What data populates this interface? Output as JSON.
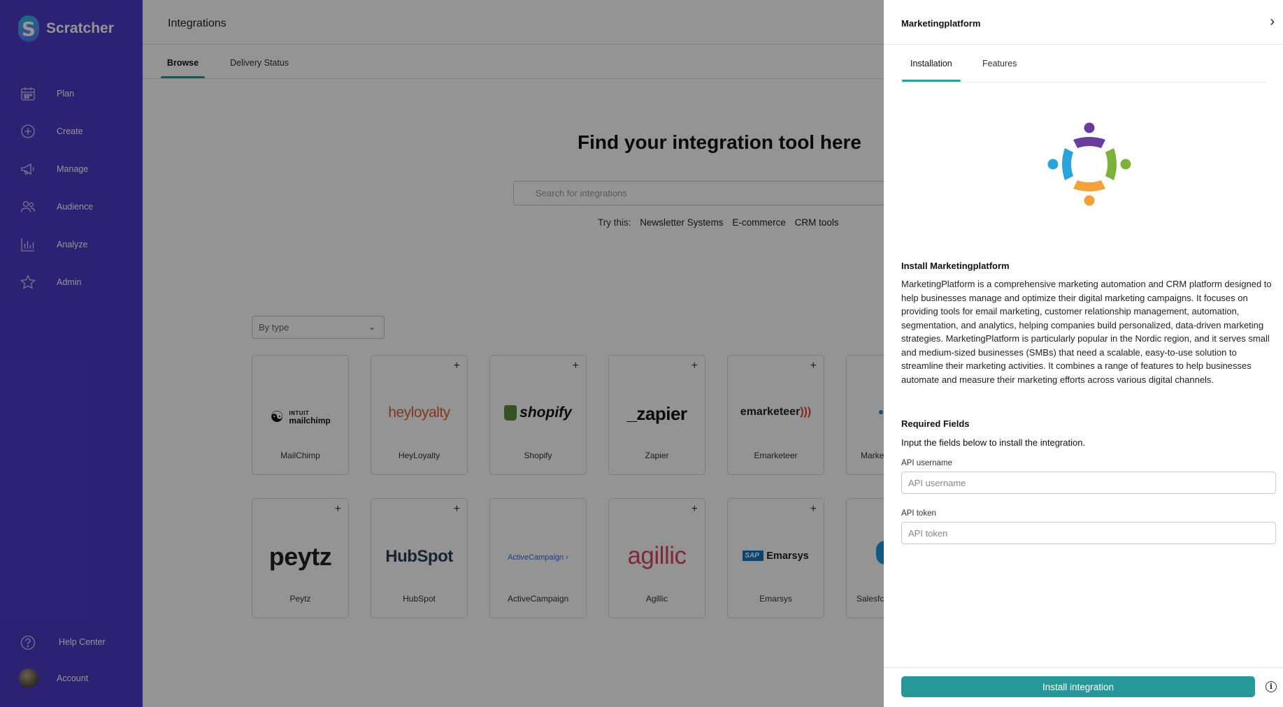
{
  "sidebar": {
    "brand": "Scratcher",
    "brand_mark": "S",
    "items": [
      {
        "label": "Plan",
        "icon": "calendar-icon"
      },
      {
        "label": "Create",
        "icon": "plus-circle-icon"
      },
      {
        "label": "Manage",
        "icon": "megaphone-icon"
      },
      {
        "label": "Audience",
        "icon": "users-icon"
      },
      {
        "label": "Analyze",
        "icon": "bar-chart-icon"
      },
      {
        "label": "Admin",
        "icon": "star-icon"
      }
    ],
    "help": "Help Center",
    "account": "Account",
    "bg_color": "#4f3ac8"
  },
  "main": {
    "title": "Integrations",
    "tabs": [
      {
        "label": "Browse",
        "active": true
      },
      {
        "label": "Delivery Status",
        "active": false
      }
    ],
    "hero": "Find your integration tool here",
    "search_placeholder": "Search for integrations",
    "try_label": "Try this:",
    "suggestions": [
      "Newsletter Systems",
      "E-commerce",
      "CRM tools"
    ],
    "filter": "By type",
    "cards_row1": [
      {
        "name": "MailChimp",
        "logo": "intuit mailchimp",
        "logo_top": "INTUIT",
        "logo_bottom": "mailchimp"
      },
      {
        "name": "HeyLoyalty",
        "logo": "heyloyalty"
      },
      {
        "name": "Shopify",
        "logo": "shopify"
      },
      {
        "name": "Zapier",
        "logo": "_zapier"
      },
      {
        "name": "Emarketeer",
        "logo": "emarketeer"
      },
      {
        "name": "Marke"
      }
    ],
    "cards_row2": [
      {
        "name": "Peytz",
        "logo": "peytz"
      },
      {
        "name": "HubSpot",
        "logo": "HubSpot"
      },
      {
        "name": "ActiveCampaign",
        "logo": "ActiveCampaign"
      },
      {
        "name": "Agillic",
        "logo": "agillic"
      },
      {
        "name": "Emarsys",
        "logo": "Emarsys",
        "logo_prefix": "SAP"
      },
      {
        "name": "Salesfc"
      }
    ],
    "plus": "+"
  },
  "panel": {
    "title": "Marketingplatform",
    "tabs": [
      {
        "label": "Installation",
        "active": true
      },
      {
        "label": "Features",
        "active": false
      }
    ],
    "install_heading": "Install Marketingplatform",
    "description": "MarketingPlatform is a comprehensive marketing automation and CRM platform designed to help businesses manage and optimize their digital marketing campaigns. It focuses on providing tools for email marketing, customer relationship management, automation, segmentation, and analytics, helping companies build personalized, data-driven marketing strategies. MarketingPlatform is particularly popular in the Nordic region, and it serves small and medium-sized businesses (SMBs) that need a scalable, easy-to-use solution to streamline their marketing activities. It combines a range of features to help businesses automate and measure their marketing efforts across various digital channels.",
    "required_heading": "Required Fields",
    "required_sub": "Input the fields below to install the integration.",
    "fields": [
      {
        "label": "API username",
        "placeholder": "API username"
      },
      {
        "label": "API token",
        "placeholder": "API token"
      }
    ],
    "install_button": "Install integration",
    "accent": "#26989a"
  }
}
